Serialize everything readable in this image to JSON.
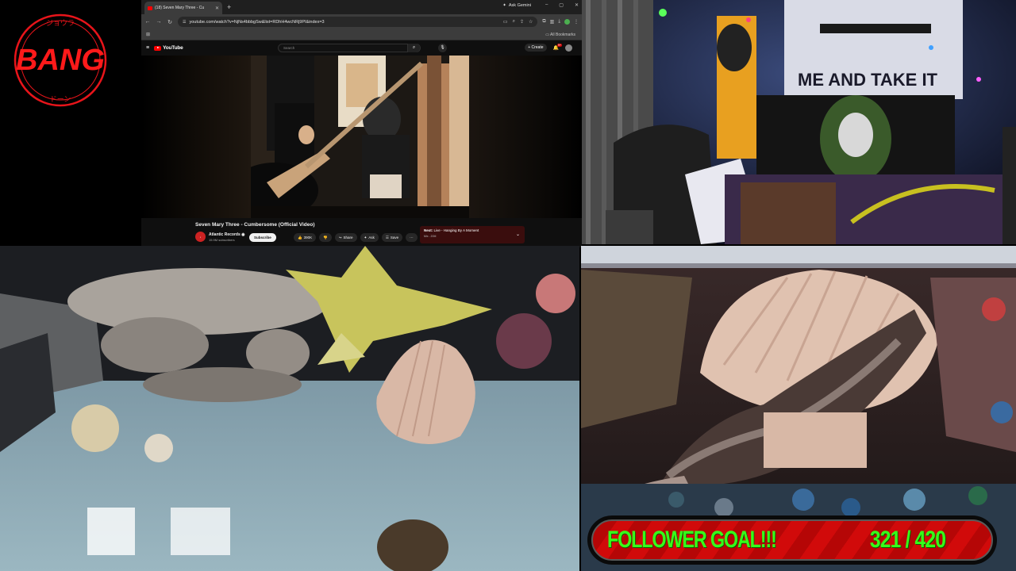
{
  "logo": {
    "text": "BANG",
    "top_ring": "ジョウラ",
    "bottom_ring": "ドーン"
  },
  "browser": {
    "tab_title": "(18) Seven Mary Three - Cu",
    "ask_gemini": "Ask Gemini",
    "url": "youtube.com/watch?v=NjNs4bbbgSw&list=RDhH4wcNRj9PI&index=3",
    "all_bookmarks": "All Bookmarks"
  },
  "youtube": {
    "logo_text": "YouTube",
    "search_placeholder": "Search",
    "create_label": "Create",
    "notif_count": "9+",
    "video_title": "Seven Mary Three - Cumbersome (Official Video)",
    "channel_name": "Atlantic Records",
    "channel_subs": "15.9M subscribers",
    "subscribe_label": "Subscribe",
    "likes": "390K",
    "share_label": "Share",
    "ask_label": "Ask",
    "save_label": "Save",
    "next_prefix": "Next:",
    "next_title": "Live - Hanging By A Moment",
    "next_meta": "Mix - 20M"
  },
  "goal": {
    "label": "FOLLOWER GOAL!!!",
    "count": "321 / 420",
    "current": 321,
    "target": 420,
    "colors": {
      "text": "#35ff1a",
      "bar": "#d10a0a"
    }
  }
}
